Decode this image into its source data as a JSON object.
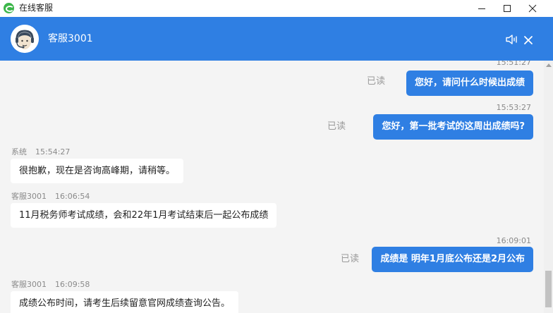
{
  "window": {
    "title": "在线客服"
  },
  "header": {
    "agent_name": "客服3001"
  },
  "icons": {
    "app": "chat-app-icon",
    "avatar": "agent-headset-avatar",
    "speaker": "speaker-icon",
    "close": "close-icon"
  },
  "colors": {
    "accent": "#2f7fe3",
    "background": "#f4f4f4",
    "incoming_bubble": "#ffffff",
    "meta_text": "#8a8a8a"
  },
  "messages": [
    {
      "type": "out",
      "time": "15:51:27",
      "read": "已读",
      "text": "您好，请问什么时候出成绩"
    },
    {
      "type": "out",
      "time": "15:53:27",
      "read": "已读",
      "text": "您好，第一批考试的这周出成绩吗?"
    },
    {
      "type": "in",
      "sender": "系统",
      "time": "15:54:27",
      "text": "很抱歉，现在是咨询高峰期，请稍等。"
    },
    {
      "type": "in",
      "sender": "客服3001",
      "time": "16:06:54",
      "text": "11月税务师考试成绩，会和22年1月考试结束后一起公布成绩"
    },
    {
      "type": "out",
      "time": "16:09:01",
      "read": "已读",
      "text": "成绩是 明年1月底公布还是2月公布"
    },
    {
      "type": "in",
      "sender": "客服3001",
      "time": "16:09:58",
      "text": "成绩公布时间，请考生后续留意官网成绩查询公告。"
    }
  ]
}
